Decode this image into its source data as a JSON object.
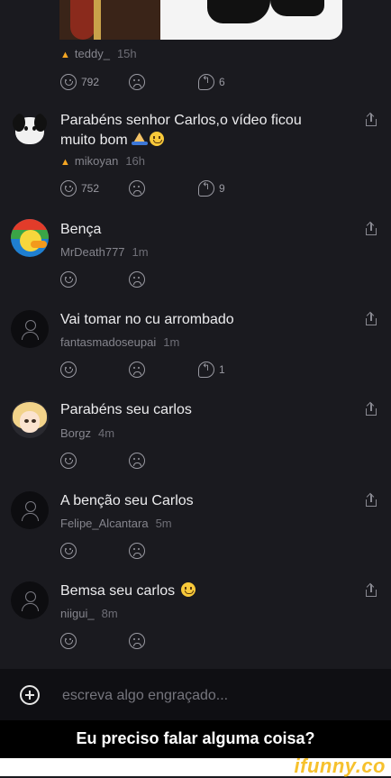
{
  "top_post": {
    "author": "teddy_",
    "age": "15h",
    "likes": "792",
    "replies": "6"
  },
  "comments": [
    {
      "text_line1": "Parabéns senhor Carlos,o vídeo ficou",
      "text_line2": "muito bom",
      "author": "mikoyan",
      "age": "16h",
      "likes": "752",
      "replies": "9"
    },
    {
      "text": "Bença",
      "author": "MrDeath777",
      "age": "1m"
    },
    {
      "text": "Vai tomar no cu arrombado",
      "author": "fantasmadoseupai",
      "age": "1m",
      "replies": "1"
    },
    {
      "text": "Parabéns seu carlos",
      "author": "Borgz",
      "age": "4m"
    },
    {
      "text": "A benção seu Carlos",
      "author": "Felipe_Alcantara",
      "age": "5m"
    },
    {
      "text": "Bemsa seu carlos",
      "author": "niigui_",
      "age": "8m"
    }
  ],
  "composer": {
    "placeholder": "escreva algo engraçado..."
  },
  "caption": "Eu preciso falar alguma coisa?",
  "watermark": "ifunny.co",
  "colors": {
    "background": "#1a1a1f",
    "flame": "#f5a623",
    "watermark": "#f6c12d"
  }
}
